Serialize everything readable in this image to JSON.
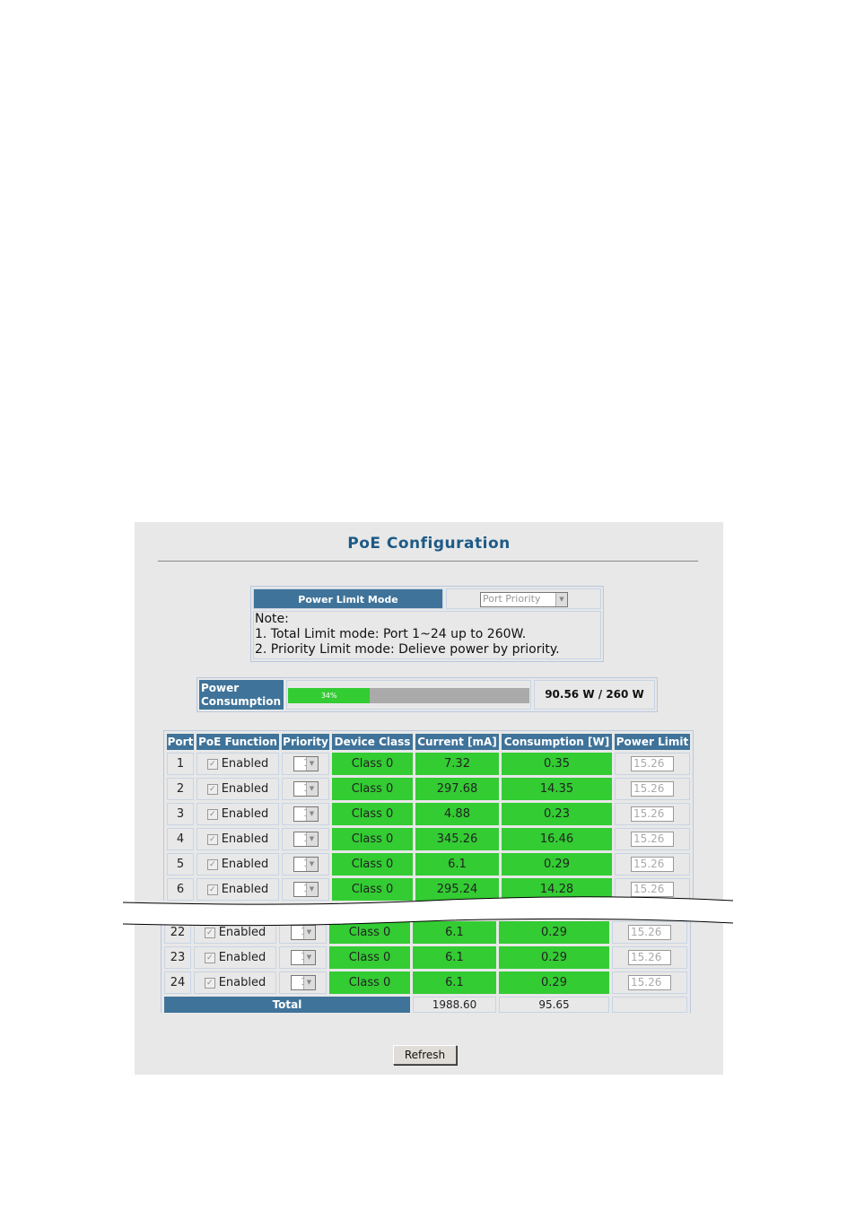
{
  "title": "PoE Configuration",
  "power_limit_mode": {
    "label": "Power Limit Mode",
    "selected": "Port Priority",
    "note_title": "Note:",
    "note_lines": [
      "1. Total Limit mode: Port 1~24 up to 260W.",
      "2. Priority Limit mode: Delieve power by priority."
    ]
  },
  "power_consumption": {
    "label_line1": "Power",
    "label_line2": "Consumption",
    "percent": 34,
    "percent_label": "34%",
    "value": "90.56 W / 260 W"
  },
  "colors": {
    "header": "#3f7399",
    "active": "#33cc33",
    "bar_bg": "#aaaaaa",
    "title": "#1d5a85"
  },
  "table": {
    "headers": [
      "Port",
      "PoE Function",
      "Priority",
      "Device Class",
      "Current [mA]",
      "Consumption [W]",
      "Power Limit"
    ],
    "rows_top": [
      {
        "port": "1",
        "function": "Enabled",
        "checked": true,
        "priority": "1",
        "class": "Class 0",
        "current": "7.32",
        "consumption": "0.35",
        "limit": "15.26"
      },
      {
        "port": "2",
        "function": "Enabled",
        "checked": true,
        "priority": "1",
        "class": "Class 0",
        "current": "297.68",
        "consumption": "14.35",
        "limit": "15.26"
      },
      {
        "port": "3",
        "function": "Enabled",
        "checked": true,
        "priority": "1",
        "class": "Class 0",
        "current": "4.88",
        "consumption": "0.23",
        "limit": "15.26"
      },
      {
        "port": "4",
        "function": "Enabled",
        "checked": true,
        "priority": "1",
        "class": "Class 0",
        "current": "345.26",
        "consumption": "16.46",
        "limit": "15.26"
      },
      {
        "port": "5",
        "function": "Enabled",
        "checked": true,
        "priority": "1",
        "class": "Class 0",
        "current": "6.1",
        "consumption": "0.29",
        "limit": "15.26"
      },
      {
        "port": "6",
        "function": "Enabled",
        "checked": true,
        "priority": "1",
        "class": "Class 0",
        "current": "295.24",
        "consumption": "14.28",
        "limit": "15.26"
      }
    ],
    "rows_bottom": [
      {
        "port": "22",
        "function": "Enabled",
        "checked": true,
        "priority": "1",
        "class": "Class 0",
        "current": "6.1",
        "consumption": "0.29",
        "limit": "15.26"
      },
      {
        "port": "23",
        "function": "Enabled",
        "checked": true,
        "priority": "1",
        "class": "Class 0",
        "current": "6.1",
        "consumption": "0.29",
        "limit": "15.26"
      },
      {
        "port": "24",
        "function": "Enabled",
        "checked": true,
        "priority": "1",
        "class": "Class 0",
        "current": "6.1",
        "consumption": "0.29",
        "limit": "15.26"
      }
    ],
    "total_label": "Total",
    "total_current": "1988.60",
    "total_consumption": "95.65"
  },
  "refresh_label": "Refresh"
}
